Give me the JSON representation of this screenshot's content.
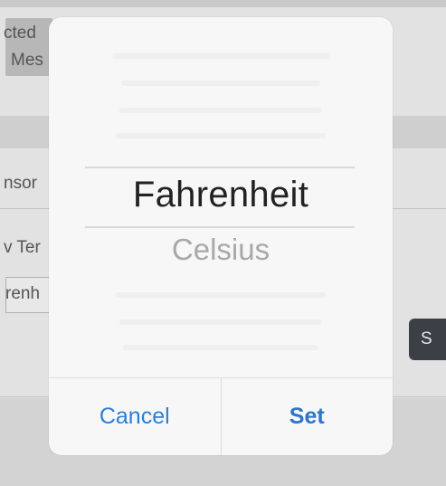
{
  "background": {
    "line1": "cted",
    "line2": "Mes",
    "section_label": "nsor",
    "field_label": "v Ter",
    "field_value": "renh",
    "button_label": "S"
  },
  "picker": {
    "selected_option": "Fahrenheit",
    "next_option": "Celsius",
    "cancel_label": "Cancel",
    "set_label": "Set"
  },
  "colors": {
    "accent": "#2b7fd6",
    "dialog_bg": "#f7f7f7",
    "dim_bg": "#dcdcdc"
  }
}
